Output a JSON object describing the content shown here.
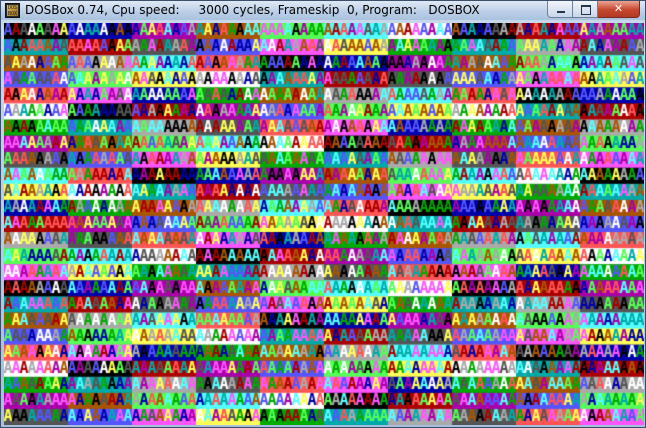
{
  "window": {
    "title": "DOSBox 0.74, Cpu speed:     3000 cycles, Frameskip  0, Program:   DOSBOX",
    "icon_text": "DOS BOX",
    "controls": {
      "minimize": "minimize",
      "maximize": "maximize",
      "close": "✕"
    }
  },
  "dos_screen": {
    "glyph": "A",
    "columns": 80,
    "rows": 25,
    "description_of_content": "",
    "cga_palette": [
      "#000000",
      "#0000aa",
      "#00aa00",
      "#00aaaa",
      "#aa0000",
      "#aa00aa",
      "#aa5500",
      "#aaaaaa",
      "#555555",
      "#5555ff",
      "#55ff55",
      "#55ffff",
      "#ff5555",
      "#ff55ff",
      "#ffff55",
      "#ffffff"
    ],
    "background_block_order": [
      0,
      1,
      2,
      3,
      4,
      5,
      6,
      7,
      8,
      9,
      10,
      11,
      12,
      13,
      14,
      15
    ]
  }
}
